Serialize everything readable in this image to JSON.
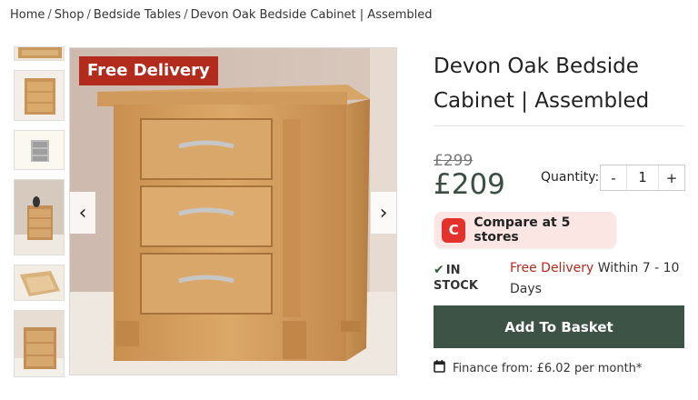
{
  "breadcrumb": {
    "items": [
      "Home",
      "Shop",
      "Bedside Tables",
      "Devon Oak Bedside Cabinet | Assembled"
    ],
    "separator": "/"
  },
  "gallery": {
    "badge": "Free Delivery",
    "prev_icon": "chevron-left-icon",
    "next_icon": "chevron-right-icon",
    "prev_glyph": "‹",
    "next_glyph": "›"
  },
  "product": {
    "title": "Devon Oak Bedside Cabinet | Assembled",
    "old_price": "£299",
    "price": "£209"
  },
  "quantity": {
    "label": "Quantity:",
    "minus": "-",
    "value": "1",
    "plus": "+"
  },
  "compare": {
    "logo_letter": "C",
    "label": "Compare at 5 stores",
    "brand_color": "#e3322b"
  },
  "stock": {
    "icon": "check-icon",
    "check": "✔",
    "line1": "IN",
    "line2": "STOCK"
  },
  "delivery": {
    "free": "Free Delivery",
    "rest": " Within 7 - 10 Days"
  },
  "basket": {
    "label": "Add To Basket",
    "color": "#3c5345"
  },
  "finance": {
    "icon": "calendar-icon",
    "text": "Finance from: £6.02 per month*"
  },
  "colors": {
    "accent_red": "#b32b1d",
    "price_green": "#3a4e43"
  }
}
